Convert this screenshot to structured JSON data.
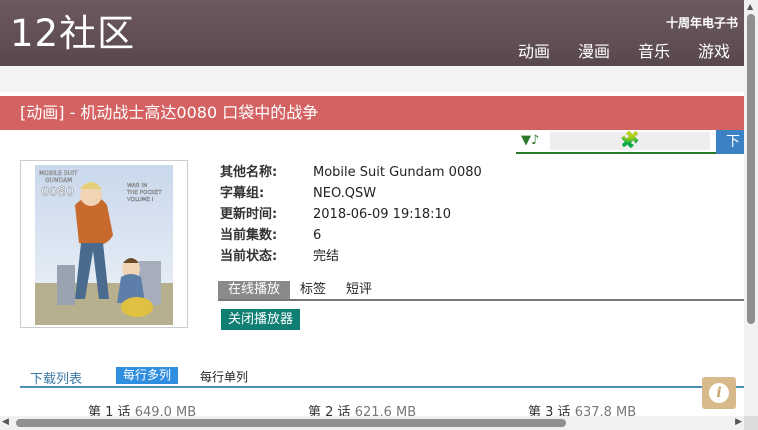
{
  "header": {
    "logo": "12社区",
    "promo": "十周年电子书",
    "nav": [
      "动画",
      "漫画",
      "音乐",
      "游戏"
    ]
  },
  "page": {
    "title": "[动画] - 机动战士高达0080 口袋中的战争"
  },
  "player_bar": {
    "music_icon": "▼♪",
    "puzzle_icon": "puzzle-icon",
    "download_label": "下"
  },
  "poster": {
    "lines": [
      "MOBILE SUIT",
      "GUNDAM",
      "0080",
      "WAR IN",
      "THE POCKET",
      "VOLUME I"
    ]
  },
  "info": {
    "rows": [
      {
        "key": "其他名称:",
        "value": "Mobile Suit Gundam 0080"
      },
      {
        "key": "字幕组:",
        "value": "NEO.QSW"
      },
      {
        "key": "更新时间:",
        "value": "2018-06-09 19:18:10"
      },
      {
        "key": "当前集数:",
        "value": "6"
      },
      {
        "key": "当前状态:",
        "value": "完结"
      }
    ]
  },
  "tabs": [
    "在线播放",
    "标签",
    "短评"
  ],
  "close_player": "关闭播放器",
  "download": {
    "label": "下载列表",
    "multi": "每行多列",
    "single": "每行单列",
    "episodes": [
      {
        "name": "第 1 话",
        "size": "649.0 MB"
      },
      {
        "name": "第 2 话",
        "size": "621.6 MB"
      },
      {
        "name": "第 3 话",
        "size": "637.8 MB"
      }
    ]
  },
  "colors": {
    "header": "#5f4d53",
    "title_bar": "#d46262",
    "close_btn": "#0f7f73",
    "multi_btn": "#2f8ee0",
    "download_btn": "#3b82c4"
  }
}
